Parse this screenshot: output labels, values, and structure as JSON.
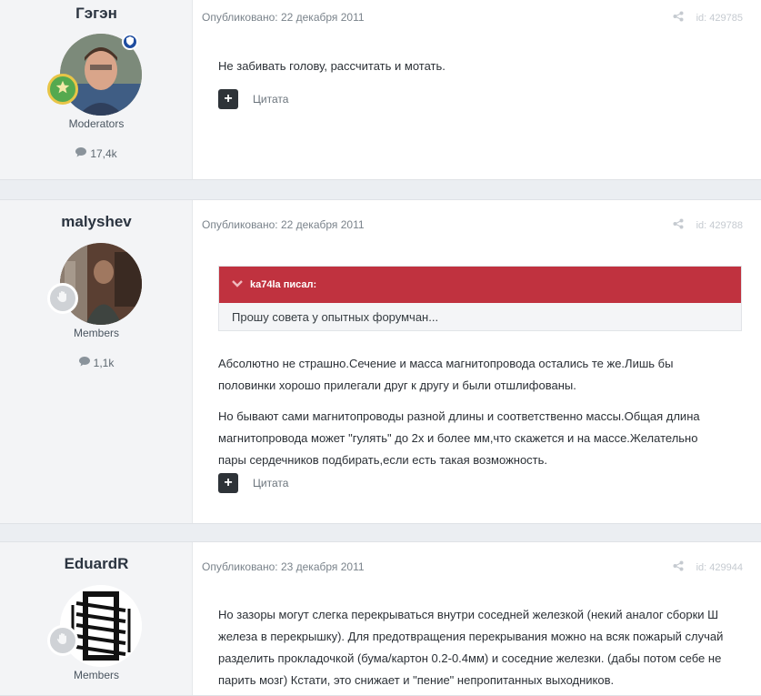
{
  "posts": [
    {
      "author": "Гэгэн",
      "group": "Moderators",
      "count": "17,4k",
      "date_line": "Опубликовано: 22 декабря 2011",
      "post_id": "id: 429785",
      "paragraphs": [
        "Не забивать голову, рассчитать и мотать."
      ],
      "quote_label": "Цитата"
    },
    {
      "author": "malyshev",
      "group": "Members",
      "count": "1,1k",
      "date_line": "Опубликовано: 22 декабря 2011",
      "post_id": "id: 429788",
      "quote": {
        "header": "ka74la писал:",
        "text": "Прошу совета у опытных форумчан..."
      },
      "paragraphs": [
        "Абсолютно не страшно.Сечение и масса магнитопровода остались те же.Лишь бы половинки хорошо прилегали друг к другу и были отшлифованы.",
        "Но бывают сами магнитопроводы разной длины и соответственно массы.Общая длина магнитопровода может \"гулять\" до 2х и более мм,что скажется и на массе.Желательно пары сердечников подбирать,если есть такая возможность."
      ],
      "quote_label": "Цитата"
    },
    {
      "author": "EduardR",
      "group": "Members",
      "date_line": "Опубликовано: 23 декабря 2011",
      "post_id": "id: 429944",
      "paragraphs": [
        "Но зазоры могут слегка перекрываться внутри соседней железкой (некий аналог сборки Ш железа в перекрышку). Для предотвращения перекрывания можно на всяк пожарый случай разделить прокладочкой (бума/картон 0.2-0.4мм) и соседние железки. (дабы потом себе не парить мозг) Кстати, это снижает и \"пение\" непропитанных выходников."
      ]
    }
  ],
  "icons": {
    "share": "share-icon",
    "comment": "comment-icon",
    "chevron": "chevron-down-icon",
    "plus": "plus-icon",
    "shield": "shield-icon",
    "star": "star-icon",
    "hand": "hand-icon"
  },
  "colors": {
    "quote_header": "#c0323f",
    "moderator_badge": "#1f4da0",
    "plus_button": "#2e3338"
  }
}
